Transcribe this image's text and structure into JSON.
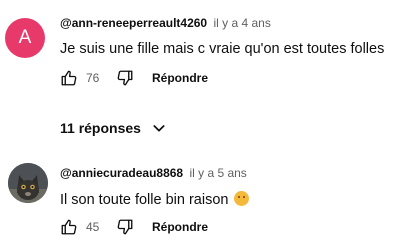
{
  "comments": [
    {
      "avatar_letter": "A",
      "author": "@ann-reneeperreault4260",
      "timestamp": "il y a 4 ans",
      "text": "Je suis une fille mais c vraie qu'on est toutes folles",
      "likes": "76",
      "reply_label": "Répondre",
      "avatar_color": "#e8396b"
    },
    {
      "author": "@anniecuradeau8868",
      "timestamp": "il y a 5 ans",
      "text": "Il son toute folle bin raison",
      "emoji": "smiling-face",
      "likes": "45",
      "reply_label": "Répondre"
    }
  ],
  "replies_toggle": {
    "label": "11 réponses",
    "icon": "chevron-down-icon"
  },
  "icons": [
    "thumbs-up-icon",
    "thumbs-down-icon"
  ]
}
